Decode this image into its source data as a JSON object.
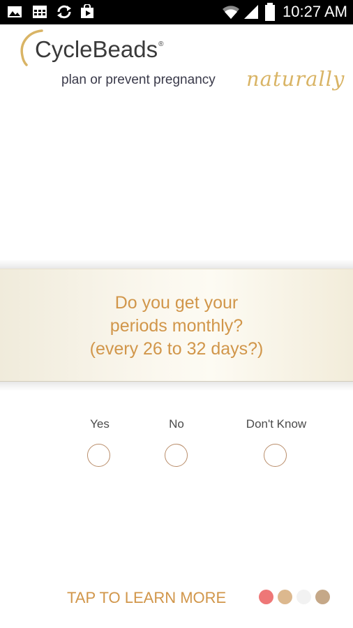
{
  "status_bar": {
    "time": "10:27 AM",
    "icons": [
      "gallery-icon",
      "calendar-icon",
      "sync-icon",
      "play-store-icon",
      "wifi-icon",
      "signal-icon",
      "battery-icon"
    ]
  },
  "header": {
    "logo_text": "CycleBeads",
    "logo_reg": "®",
    "tagline": "plan or prevent pregnancy",
    "tagline_script": "naturally"
  },
  "question": {
    "line1": "Do you get your",
    "line2": "periods monthly?",
    "line3": "(every 26 to 32 days?)"
  },
  "options": [
    {
      "label": "Yes"
    },
    {
      "label": "No"
    },
    {
      "label": "Don't Know"
    }
  ],
  "footer": {
    "learn_more": "TAP TO LEARN MORE"
  },
  "colors": {
    "accent": "#d1964a",
    "bead_red": "#ee7777",
    "bead_tan": "#dcb88e",
    "bead_white": "#f2f2f2",
    "bead_brown": "#c5a888",
    "radio_border": "#b98d6a"
  }
}
